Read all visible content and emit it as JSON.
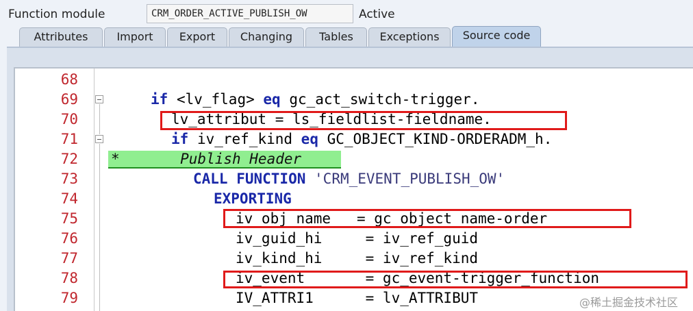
{
  "header": {
    "label": "Function module",
    "name_value": "CRM_ORDER_ACTIVE_PUBLISH_OW",
    "status": "Active"
  },
  "tabs": [
    {
      "label": "Attributes",
      "active": false
    },
    {
      "label": "Import",
      "active": false
    },
    {
      "label": "Export",
      "active": false
    },
    {
      "label": "Changing",
      "active": false
    },
    {
      "label": "Tables",
      "active": false
    },
    {
      "label": "Exceptions",
      "active": false
    },
    {
      "label": "Source code",
      "active": true
    }
  ],
  "editor": {
    "lines": [
      {
        "number": "68",
        "text": ""
      },
      {
        "number": "69",
        "text": "if <lv_flag> eq gc_act_switch-trigger."
      },
      {
        "number": "70",
        "text": "lv_attribut = ls_fieldlist-fieldname."
      },
      {
        "number": "71",
        "text": "if iv_ref_kind eq GC_OBJECT_KIND-ORDERADM_h."
      },
      {
        "number": "72",
        "text": "*       Publish Header"
      },
      {
        "number": "73",
        "text": "CALL FUNCTION 'CRM_EVENT_PUBLISH_OW'"
      },
      {
        "number": "74",
        "text": "EXPORTING"
      },
      {
        "number": "75",
        "text": "iv_obj_name   = gc_object_name-order"
      },
      {
        "number": "76",
        "text": "iv_guid_hi     = iv_ref_guid"
      },
      {
        "number": "77",
        "text": "iv_kind_hi     = iv_ref_kind"
      },
      {
        "number": "78",
        "text": "iv_event       = gc_event-trigger_function"
      },
      {
        "number": "79",
        "text": "IV_ATTRI1      = lv_ATTRIBUT"
      }
    ]
  },
  "watermark": "@稀土掘金技术社区",
  "colors": {
    "line_number": "#c0262d",
    "keyword": "#1a28a8",
    "highlight_box": "#e01a1a",
    "comment_bg": "#90ee90"
  }
}
